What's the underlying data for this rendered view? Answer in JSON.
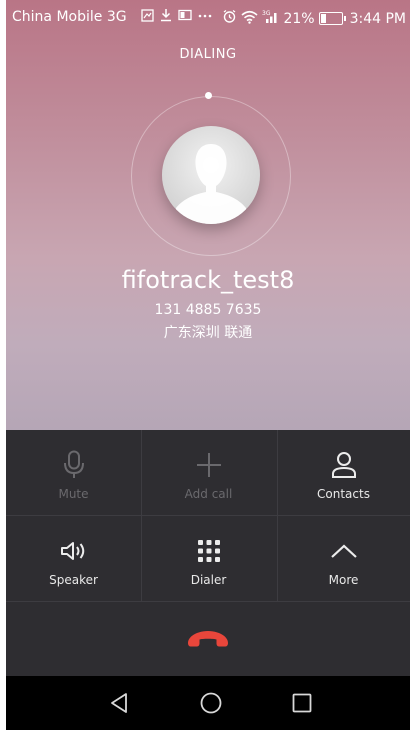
{
  "status_bar": {
    "carrier": "China Mobile 3G",
    "battery": "21%",
    "time": "3:44 PM",
    "icons": [
      "sim-icon",
      "download-icon",
      "screen-icon",
      "more-dots-icon",
      "alarm-icon",
      "wifi-icon",
      "signal-3g-icon",
      "battery-icon"
    ]
  },
  "call": {
    "status": "DIALING",
    "contact_name": "fifotrack_test8",
    "phone_number": "131 4885 7635",
    "location": "广东深圳 联通"
  },
  "controls": {
    "mute_label": "Mute",
    "add_call_label": "Add call",
    "contacts_label": "Contacts",
    "speaker_label": "Speaker",
    "dialer_label": "Dialer",
    "more_label": "More"
  },
  "colors": {
    "end_call": "#e8463b",
    "panel_bg": "#2e2d31"
  }
}
